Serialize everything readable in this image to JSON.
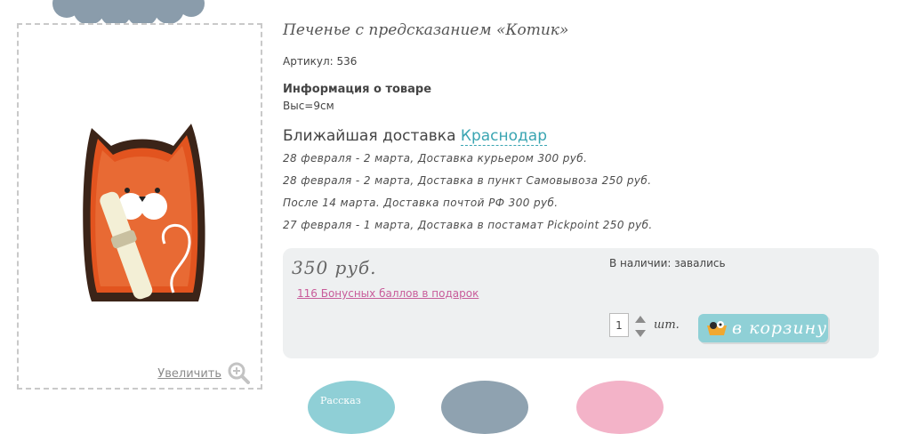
{
  "product": {
    "title": "Печенье с предсказанием «Котик»",
    "sku": "Артикул: 536",
    "info_heading": "Информация о товаре",
    "info_value": "Выс=9см",
    "zoom_label": "Увеличить"
  },
  "delivery": {
    "heading": "Ближайшая доставка",
    "city": "Краснодар",
    "options": [
      "28 февраля - 2 марта, Доставка курьером 300 руб.",
      "28 февраля - 2 марта, Доставка в пункт Самовывоза 250 руб.",
      "После 14 марта. Доставка почтой РФ 300 руб.",
      "27 февраля - 1 марта, Доставка в постамат Pickpoint 250 руб."
    ]
  },
  "purchase": {
    "price": "350 руб.",
    "bonus_link": "116 Бонусных баллов в подарок",
    "stock": "В наличии: завались",
    "quantity": "1",
    "unit": "шт.",
    "cart_button": "в корзину"
  },
  "bottom_buttons": {
    "first_label": "Рассказ"
  },
  "colors": {
    "accent_teal": "#3aa5b2",
    "button_teal": "#8fd0d6",
    "bonus_pink": "#c85c9a",
    "box_gray": "#eef0f1"
  },
  "icons": [
    "cloud-decoration",
    "cookie-photo",
    "zoom-icon",
    "cart-icon"
  ]
}
